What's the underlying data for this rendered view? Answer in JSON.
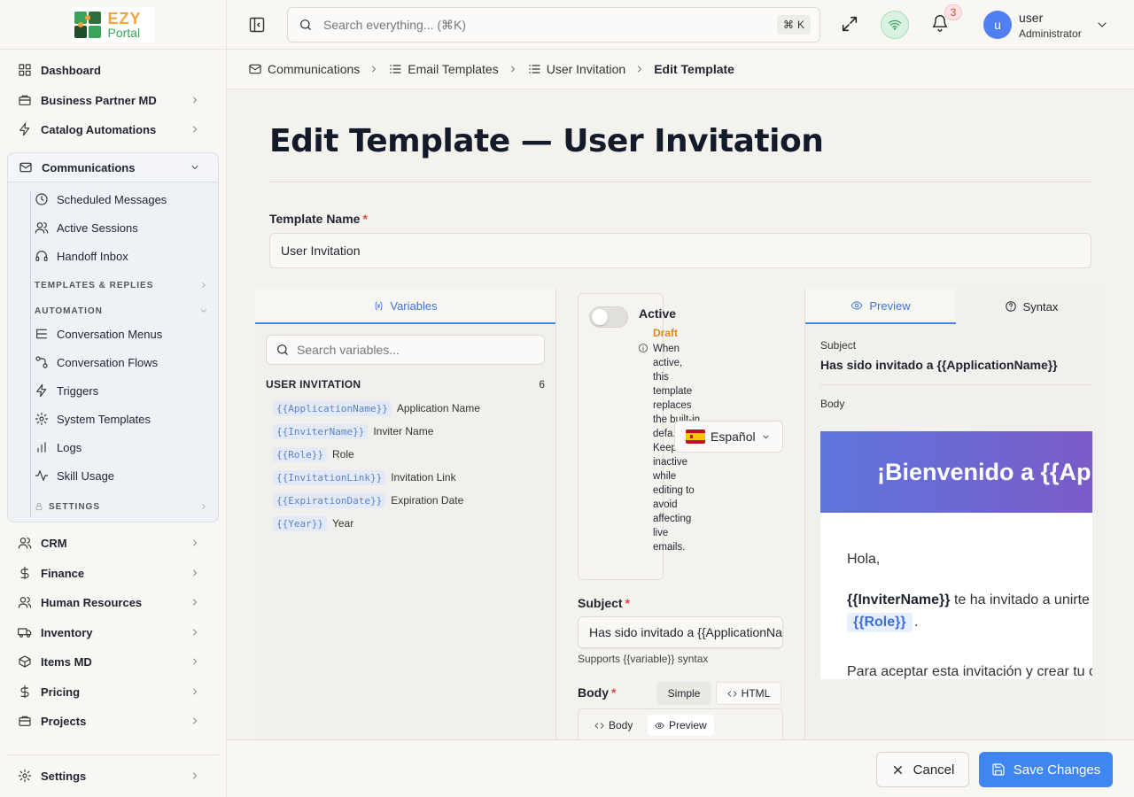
{
  "brand": {
    "ezy": "EZY",
    "portal": "Portal"
  },
  "sidebar": {
    "top_items": [
      {
        "label": "Dashboard",
        "icon": "dashboard-icon"
      },
      {
        "label": "Business Partner MD",
        "icon": "briefcase-icon"
      },
      {
        "label": "Catalog Automations",
        "icon": "bolt-icon"
      }
    ],
    "communications": {
      "label": "Communications",
      "items": [
        {
          "label": "Scheduled Messages",
          "icon": "clock-icon"
        },
        {
          "label": "Active Sessions",
          "icon": "users-icon"
        },
        {
          "label": "Handoff Inbox",
          "icon": "headset-icon"
        }
      ],
      "templates_heading": "TEMPLATES & REPLIES",
      "automation_heading": "AUTOMATION",
      "automation_items": [
        {
          "label": "Conversation Menus",
          "icon": "list-tree-icon"
        },
        {
          "label": "Conversation Flows",
          "icon": "flow-icon"
        },
        {
          "label": "Triggers",
          "icon": "bolt-icon"
        },
        {
          "label": "System Templates",
          "icon": "gear-icon"
        },
        {
          "label": "Logs",
          "icon": "bar-chart-icon"
        },
        {
          "label": "Skill Usage",
          "icon": "activity-icon"
        }
      ],
      "settings_heading": "SETTINGS"
    },
    "bottom_items": [
      {
        "label": "CRM",
        "icon": "users-icon"
      },
      {
        "label": "Finance",
        "icon": "dollar-icon"
      },
      {
        "label": "Human Resources",
        "icon": "people-icon"
      },
      {
        "label": "Inventory",
        "icon": "truck-icon"
      },
      {
        "label": "Items MD",
        "icon": "box-icon"
      },
      {
        "label": "Pricing",
        "icon": "dollar-icon"
      },
      {
        "label": "Projects",
        "icon": "briefcase-icon"
      }
    ],
    "settings_label": "Settings"
  },
  "topbar": {
    "search_placeholder": "Search everything... (⌘K)",
    "kbd_cmd": "⌘",
    "kbd_key": "K",
    "notification_count": "3",
    "avatar_initial": "u",
    "user_name": "user",
    "user_role": "Administrator"
  },
  "breadcrumb": [
    "Communications",
    "Email Templates",
    "User Invitation",
    "Edit Template"
  ],
  "page": {
    "title": "Edit Template — User Invitation",
    "template_name_label": "Template Name",
    "required_mark": "*",
    "template_name_value": "User Invitation"
  },
  "variables": {
    "tab_label": "Variables",
    "search_placeholder": "Search variables...",
    "group_label": "USER INVITATION",
    "group_count": "6",
    "items": [
      {
        "token": "{{ApplicationName}}",
        "label": "Application Name"
      },
      {
        "token": "{{InviterName}}",
        "label": "Inviter Name"
      },
      {
        "token": "{{Role}}",
        "label": "Role"
      },
      {
        "token": "{{InvitationLink}}",
        "label": "Invitation Link"
      },
      {
        "token": "{{ExpirationDate}}",
        "label": "Expiration Date"
      },
      {
        "token": "{{Year}}",
        "label": "Year"
      }
    ]
  },
  "editor": {
    "active_label": "Active",
    "active_on": false,
    "status": "Draft",
    "info_text": "When active, this template replaces the built-in defa... Keep inactive while editing to avoid affecting live emails.",
    "language": "Español",
    "subject_label": "Subject",
    "subject_value": "Has sido invitado a {{ApplicationName}}",
    "subject_hint": "Supports {{variable}} syntax",
    "body_label": "Body",
    "mode_simple": "Simple",
    "mode_html": "HTML",
    "body_tab": "Body",
    "preview_tab": "Preview"
  },
  "preview": {
    "tab_preview": "Preview",
    "tab_syntax": "Syntax",
    "subject_label": "Subject",
    "subject_value": "Has sido invitado a {{ApplicationName}}",
    "body_label": "Body",
    "banner_text": "¡Bienvenido a {{ApplicationName}}!",
    "greeting": "Hola,",
    "inviter_token": "{{InviterName}}",
    "line1_rest": "te ha invitado a unirte a {{ApplicationName}} como",
    "role_token": "{{Role}}",
    "role_after": ".",
    "line3": "Para aceptar esta invitación y crear tu cuenta, haz clic en el siguiente enlace:"
  },
  "footer": {
    "cancel_label": "Cancel",
    "save_label": "Save Changes"
  },
  "colors": {
    "accent": "#3f86f3",
    "draft": "#e08a1a",
    "required": "#e04848",
    "banner_start": "#5e75dd",
    "banner_end": "#7b5cc7"
  }
}
